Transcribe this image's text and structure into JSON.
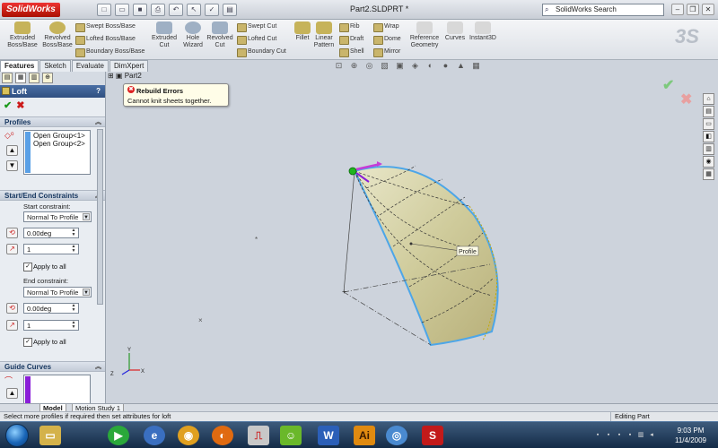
{
  "app": {
    "brand": "SolidWorks",
    "filename": "Part2.SLDPRT *",
    "search_placeholder": "SolidWorks Search"
  },
  "toolbar": {
    "extruded_boss": "Extruded Boss/Base",
    "revolved_boss": "Revolved Boss/Base",
    "swept_boss": "Swept Boss/Base",
    "lofted_boss": "Lofted Boss/Base",
    "boundary_boss": "Boundary Boss/Base",
    "extruded_cut": "Extruded Cut",
    "hole_wizard": "Hole Wizard",
    "revolved_cut": "Revolved Cut",
    "swept_cut": "Swept Cut",
    "lofted_cut": "Lofted Cut",
    "boundary_cut": "Boundary Cut",
    "fillet": "Fillet",
    "linear_pattern": "Linear Pattern",
    "rib": "Rib",
    "draft": "Draft",
    "shell": "Shell",
    "wrap": "Wrap",
    "dome": "Dome",
    "mirror": "Mirror",
    "reference_geometry": "Reference Geometry",
    "curves": "Curves",
    "instant3d": "Instant3D"
  },
  "tabs": [
    "Features",
    "Sketch",
    "Evaluate",
    "DimXpert"
  ],
  "panel": {
    "title": "Loft",
    "help": "?",
    "profiles_header": "Profiles",
    "profiles": [
      "Open Group<1>",
      "Open Group<2>"
    ],
    "start_end_header": "Start/End Constraints",
    "start_constraint_label": "Start constraint:",
    "start_constraint_value": "Normal To Profile",
    "start_angle": "0.00deg",
    "start_length": "1",
    "start_apply_all": "Apply to all",
    "end_constraint_label": "End constraint:",
    "end_constraint_value": "Normal To Profile",
    "end_angle": "0.00deg",
    "end_length": "1",
    "end_apply_all": "Apply to all",
    "guide_curves_header": "Guide Curves"
  },
  "tree": {
    "root": "Part2"
  },
  "error": {
    "title": "Rebuild Errors",
    "message": "Cannot knit sheets together."
  },
  "viewport": {
    "profile_tag": "Profile"
  },
  "bottom_tabs": [
    "Model",
    "Motion Study 1"
  ],
  "status": {
    "message": "Select more profiles if required then set attributes for loft",
    "mode": "Editing Part"
  },
  "taskbar": {
    "time": "9:03 PM",
    "date": "11/4/2009"
  },
  "colors": {
    "surface": "#c8c496",
    "highlight": "#4da6e8",
    "viewport_bg": "#cdd3dc"
  }
}
